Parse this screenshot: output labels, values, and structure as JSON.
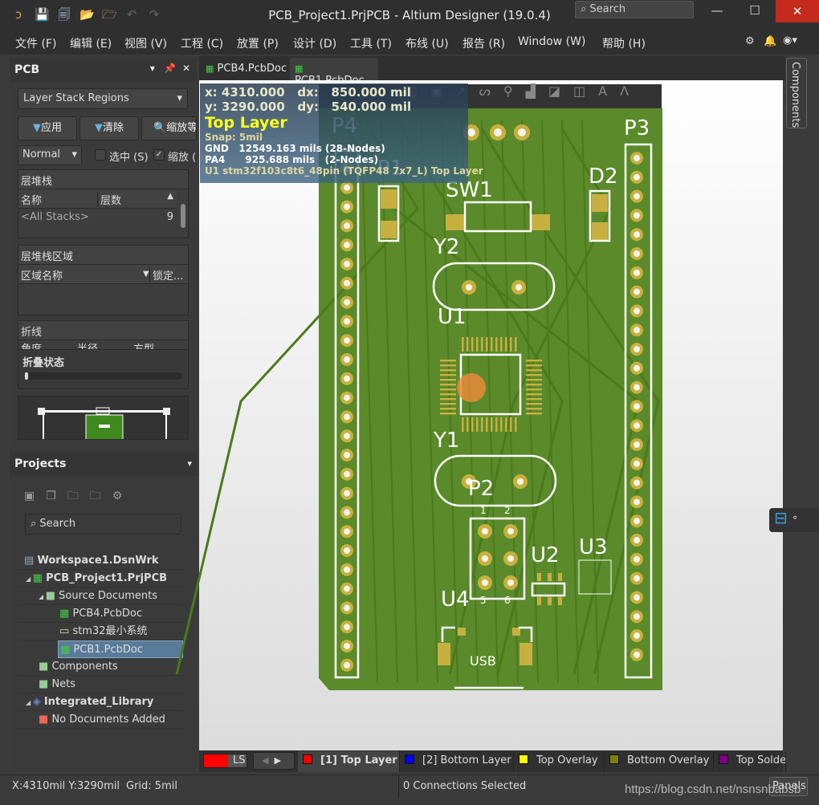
{
  "window": {
    "title": "PCB_Project1.PrjPCB - Altium Designer (19.0.4)",
    "search_placeholder": "Search",
    "minimize": "—",
    "maximize": "☐",
    "close": "✕"
  },
  "quick_toolbar": {
    "icons": [
      "altium-logo-icon",
      "save-icon",
      "save-all-icon",
      "open-icon",
      "open-project-icon",
      "undo-icon",
      "redo-icon"
    ]
  },
  "menu": [
    "文件 (F)",
    "编辑 (E)",
    "视图 (V)",
    "工程 (C)",
    "放置 (P)",
    "设计 (D)",
    "工具 (T)",
    "布线 (U)",
    "报告 (R)",
    "Window (W)",
    "帮助 (H)"
  ],
  "pcb_panel": {
    "title": "PCB",
    "mode_select": "Layer Stack Regions",
    "apply": "应用",
    "clear": "清除",
    "zoom": "缩放等",
    "view_select": "Normal",
    "select_label": "选中 (S)",
    "select_checked": false,
    "zoom_label": "缩放 (",
    "zoom_checked": true,
    "stack_section": {
      "title": "层堆栈",
      "col_name": "名称",
      "col_layers": "层数",
      "rows": [
        {
          "name": "<All Stacks>",
          "layers": "9"
        }
      ]
    },
    "region_section": {
      "title": "层堆栈区域",
      "col_name": "区域名称",
      "col_locked": "锁定..."
    },
    "bend_section": {
      "title": "折线",
      "cols": [
        "角度",
        "半径",
        "方型"
      ]
    },
    "fold_state": {
      "title": "折叠状态",
      "value": 0
    }
  },
  "projects_panel": {
    "title": "Projects",
    "search_placeholder": "Search",
    "tree": [
      {
        "label": "Workspace1.DsnWrk",
        "bold": true,
        "level": 0
      },
      {
        "label": "PCB_Project1.PrjPCB",
        "bold": true,
        "level": 1,
        "expanded": true
      },
      {
        "label": "Source Documents",
        "level": 2,
        "expanded": true
      },
      {
        "label": "PCB4.PcbDoc",
        "level": 3
      },
      {
        "label": "stm32最小系统",
        "level": 3
      },
      {
        "label": "PCB1.PcbDoc",
        "level": 3,
        "selected": true
      },
      {
        "label": "Components",
        "level": 2
      },
      {
        "label": "Nets",
        "level": 2
      },
      {
        "label": "Integrated_Library",
        "bold": true,
        "level": 1,
        "expanded": true
      },
      {
        "label": "No Documents Added",
        "level": 2
      }
    ]
  },
  "doc_tabs": [
    {
      "label": "PCB4.PcbDoc",
      "active": false
    },
    {
      "label": "PCB1.PcbDoc",
      "active": true
    }
  ],
  "right_tab": "Components",
  "hud": {
    "x_label": "x:",
    "x": "4310.000",
    "dx_label": "dx:",
    "dx": "850.000 mil",
    "y_label": "y:",
    "y": "3290.000",
    "dy_label": "dy:",
    "dy": "540.000 mil",
    "layer": "Top Layer",
    "snap": "Snap: 5mil",
    "net1": "GND   12549.163 mils (28-Nodes)",
    "net2": "PA4      925.688 mils   (2-Nodes)",
    "component": "U1 stm32f103c8t6_48pin (TQFP48 7x7_L) Top Layer"
  },
  "pcb": {
    "designators": [
      "P4",
      "P1",
      "SW1",
      "D2",
      "P3",
      "Y2",
      "U1",
      "Y1",
      "P2",
      "U2",
      "U3",
      "U4",
      "USB"
    ],
    "pin_labels": [
      "1",
      "2",
      "5",
      "6"
    ],
    "board_color": "#5f8f2a",
    "pad_color": "#c8b040",
    "silk_color": "#ffffff"
  },
  "layer_tabs": {
    "current_swatch": "#ff0000",
    "ls": "LS",
    "tabs": [
      {
        "label": "[1] Top Layer",
        "color": "#ff0000",
        "active": true
      },
      {
        "label": "[2] Bottom Layer",
        "color": "#0000ff"
      },
      {
        "label": "Top Overlay",
        "color": "#ffff00"
      },
      {
        "label": "Bottom Overlay",
        "color": "#808000"
      },
      {
        "label": "Top Solder",
        "color": "#800080"
      }
    ]
  },
  "status": {
    "coords": "X:4310mil Y:3290mil",
    "grid": "Grid: 5mil",
    "connections": "0 Connections Selected",
    "panels": "Panels",
    "watermark": "https://blog.csdn.net/nsnsnbabsb"
  }
}
